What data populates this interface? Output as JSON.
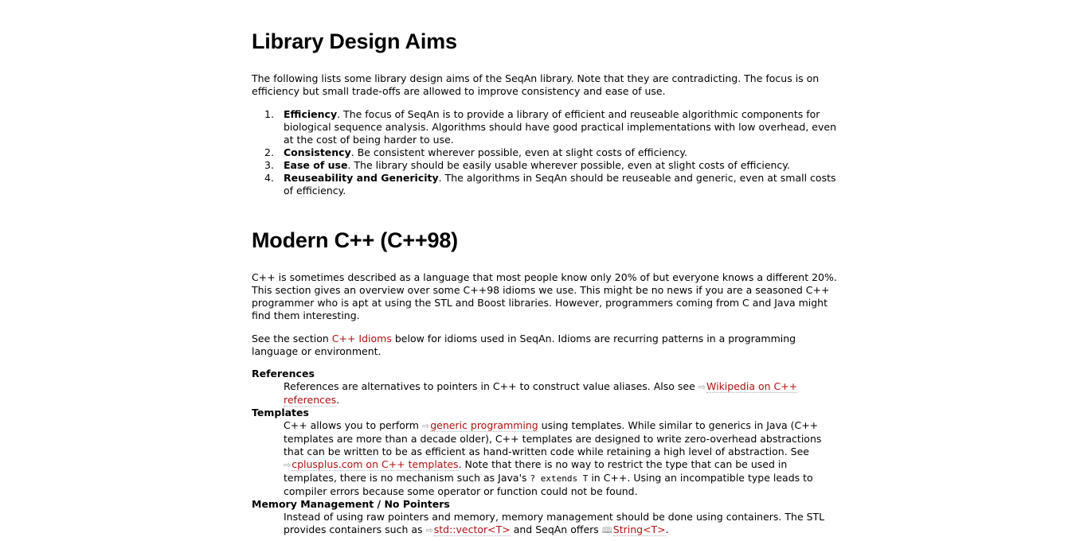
{
  "section1": {
    "title": "Library Design Aims",
    "intro": "The following lists some library design aims of the SeqAn library. Note that they are contradicting. The focus is on efficiency but small trade-offs are allowed to improve consistency and ease of use.",
    "aims": [
      {
        "num": "1.",
        "term": "Efficiency",
        "text": ". The focus of SeqAn is to provide a library of efficient and reuseable algorithmic components for biological sequence analysis. Algorithms should have good practical implementations with low overhead, even at the cost of being harder to use."
      },
      {
        "num": "2.",
        "term": "Consistency",
        "text": ". Be consistent wherever possible, even at slight costs of efficiency."
      },
      {
        "num": "3.",
        "term": "Ease of use",
        "text": ". The library should be easily usable wherever possible, even at slight costs of efficiency."
      },
      {
        "num": "4.",
        "term": "Reuseability and Genericity",
        "text": ". The algorithms in SeqAn should be reuseable and generic, even at small costs of efficiency."
      }
    ]
  },
  "section2": {
    "title": "Modern C++ (C++98)",
    "intro": "C++ is sometimes described as a language that most people know only 20% of but everyone knows a different 20%. This section gives an overview over some C++98 idioms we use. This might be no news if you are a seasoned C++ programmer who is apt at using the STL and Boost libraries. However, programmers coming from C and Java might find them interesting.",
    "see_pre": "See the section ",
    "see_link": "C++ Idioms",
    "see_post": " below for idioms used in SeqAn. Idioms are recurring patterns in a programming language or environment.",
    "references": {
      "term": "References",
      "text_pre": "References are alternatives to pointers in C++ to construct value aliases. Also see ",
      "link": "Wikipedia on C++ references",
      "text_post": "."
    },
    "templates": {
      "term": "Templates",
      "text_pre": "C++ allows you to perform ",
      "link1": "generic programming",
      "text_mid": " using templates. While similar to generics in Java (C++ templates are more than a decade older), C++ templates are designed to write zero-overhead abstractions that can be written to be as efficient as hand-written code while retaining a high level of abstraction. See ",
      "link2": "cplusplus.com on C++ templates",
      "text_mid2": ". Note that there is no way to restrict the type that can be used in templates, there is no mechanism such as Java's ",
      "code": "? extends T",
      "text_post": " in C++. Using an incompatible type leads to compiler errors because some operator or function could not be found."
    },
    "memory": {
      "term": "Memory Management / No Pointers",
      "text_pre": "Instead of using raw pointers and memory, memory management should be done using containers. The STL provides containers such as ",
      "link1": "std::vector<T>",
      "text_mid": " and SeqAn offers ",
      "link2": "String<T>",
      "text_post": "."
    }
  },
  "icons": {
    "external": "external-link-icon",
    "book": "book-icon"
  },
  "colors": {
    "link": "#b01010"
  }
}
